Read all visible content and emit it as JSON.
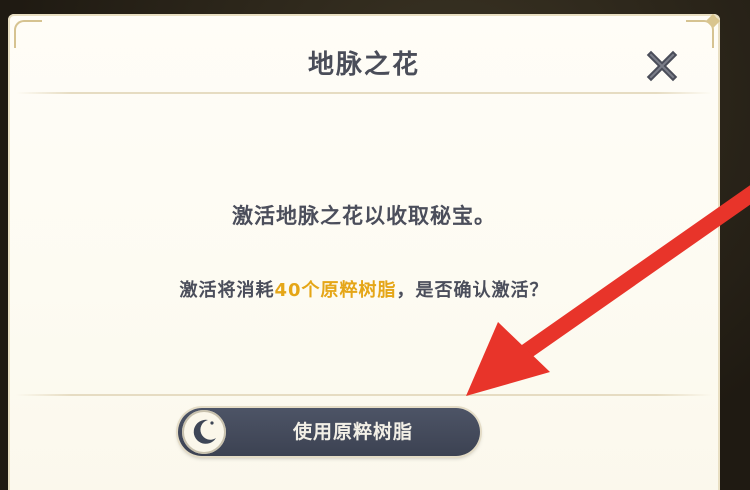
{
  "dialog": {
    "title": "地脉之花",
    "message": "激活地脉之花以收取秘宝。",
    "cost_line": {
      "prefix": "激活将消耗",
      "amount": "40个原粹树脂",
      "suffix": "，是否确认激活？",
      "highlight_color": "#e5a617"
    },
    "confirm_button": {
      "label": "使用原粹树脂",
      "icon": "moon-resin-icon"
    },
    "close_icon": "close-icon"
  },
  "annotation": {
    "arrow_color": "#e8342a"
  }
}
